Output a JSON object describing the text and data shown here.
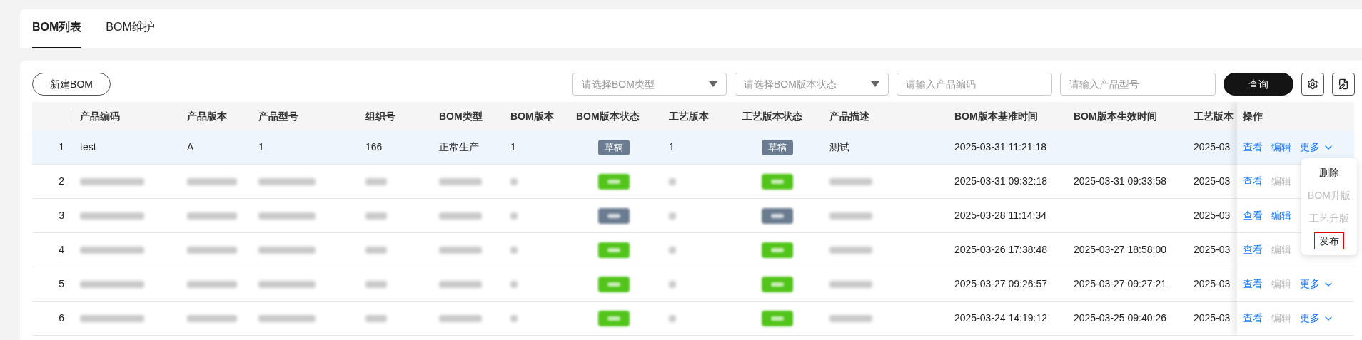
{
  "tabs": [
    {
      "label": "BOM列表",
      "selected": true
    },
    {
      "label": "BOM维护",
      "selected": false
    }
  ],
  "toolbar": {
    "new_button": "新建BOM",
    "filters": [
      {
        "kind": "select",
        "placeholder": "请选择BOM类型"
      },
      {
        "kind": "select",
        "placeholder": "请选择BOM版本状态"
      },
      {
        "kind": "input",
        "placeholder": "请输入产品编码"
      },
      {
        "kind": "input",
        "placeholder": "请输入产品型号"
      }
    ],
    "query_button": "查询"
  },
  "table": {
    "columns": [
      "产品编码",
      "产品版本",
      "产品型号",
      "组织号",
      "BOM类型",
      "BOM版本",
      "BOM版本状态",
      "工艺版本",
      "工艺版本状态",
      "产品描述",
      "BOM版本基准时间",
      "BOM版本生效时间",
      "工艺版本"
    ],
    "actions_column": "操作",
    "rows": [
      {
        "index": "1",
        "selected": true,
        "redacted": false,
        "product_code": "test",
        "product_version": "A",
        "product_model": "1",
        "org": "166",
        "bom_type": "正常生产",
        "bom_version": "1",
        "bom_status": {
          "label": "草稿",
          "color": "#6b7c90"
        },
        "craft_version": "1",
        "craft_status": {
          "label": "草稿",
          "color": "#6b7c90"
        },
        "description": "测试",
        "base_time": "2025-03-31 11:21:18",
        "effective_time": "",
        "craft_time": "2025-03",
        "view": "查看",
        "edit": {
          "label": "编辑",
          "disabled": false
        },
        "more": {
          "label": "更多",
          "expanded": true
        }
      },
      {
        "index": "2",
        "selected": false,
        "redacted": true,
        "bom_status": {
          "color": "#52c41a"
        },
        "craft_status": {
          "color": "#52c41a"
        },
        "base_time": "2025-03-31 09:32:18",
        "effective_time": "2025-03-31 09:33:58",
        "craft_time": "2025-03",
        "view": "查看",
        "edit": {
          "label": "编辑",
          "disabled": true
        }
      },
      {
        "index": "3",
        "selected": false,
        "redacted": true,
        "bom_status": {
          "color": "#6b7c90"
        },
        "craft_status": {
          "color": "#6b7c90"
        },
        "base_time": "2025-03-28 11:14:34",
        "effective_time": "",
        "craft_time": "2025-03",
        "view": "查看",
        "edit": {
          "label": "编辑",
          "disabled": false
        }
      },
      {
        "index": "4",
        "selected": false,
        "redacted": true,
        "bom_status": {
          "color": "#52c41a"
        },
        "craft_status": {
          "color": "#52c41a"
        },
        "base_time": "2025-03-26 17:38:48",
        "effective_time": "2025-03-27 18:58:00",
        "craft_time": "2025-03",
        "view": "查看",
        "edit": {
          "label": "编辑",
          "disabled": true
        }
      },
      {
        "index": "5",
        "selected": false,
        "redacted": true,
        "bom_status": {
          "color": "#52c41a"
        },
        "craft_status": {
          "color": "#52c41a"
        },
        "base_time": "2025-03-27 09:26:57",
        "effective_time": "2025-03-27 09:27:21",
        "craft_time": "2025-03",
        "view": "查看",
        "edit": {
          "label": "编辑",
          "disabled": true
        },
        "more": {
          "label": "更多",
          "expanded": false
        }
      },
      {
        "index": "6",
        "selected": false,
        "redacted": true,
        "bom_status": {
          "color": "#52c41a"
        },
        "craft_status": {
          "color": "#52c41a"
        },
        "base_time": "2025-03-24 14:19:12",
        "effective_time": "2025-03-25 09:40:26",
        "craft_time": "2025-03",
        "view": "查看",
        "edit": {
          "label": "编辑",
          "disabled": true
        },
        "more": {
          "label": "更多",
          "expanded": false
        }
      }
    ]
  },
  "more_menu": [
    {
      "label": "删除",
      "disabled": false,
      "highlighted": false
    },
    {
      "label": "BOM升版",
      "disabled": true,
      "highlighted": false
    },
    {
      "label": "工艺升版",
      "disabled": true,
      "highlighted": false
    },
    {
      "label": "发布",
      "disabled": false,
      "highlighted": true
    }
  ]
}
